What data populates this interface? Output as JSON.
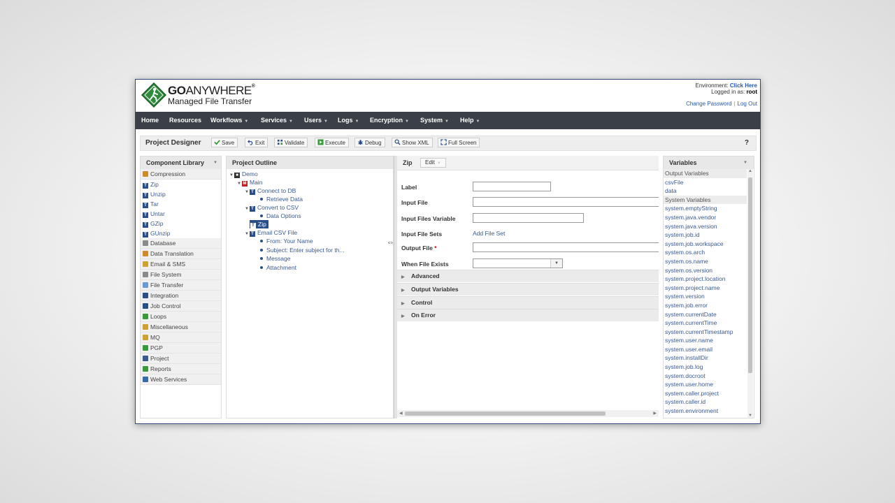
{
  "brand": {
    "go": "GO",
    "anywhere": "ANYWHERE",
    "reg": "®",
    "subtitle": "Managed File Transfer"
  },
  "env": {
    "environment_label": "Environment:",
    "environment_link": "Click Here",
    "logged_label": "Logged in as:",
    "user": "root",
    "change_password": "Change Password",
    "separator": "|",
    "logout": "Log Out"
  },
  "nav": [
    "Home",
    "Resources",
    "Workflows",
    "Services",
    "Users",
    "Logs",
    "Encryption",
    "System",
    "Help"
  ],
  "toolbar": {
    "title": "Project Designer",
    "save": "Save",
    "exit": "Exit",
    "validate": "Validate",
    "execute": "Execute",
    "debug": "Debug",
    "show_xml": "Show XML",
    "full_screen": "Full Screen",
    "help": "?"
  },
  "component_library": {
    "title": "Component Library",
    "items": [
      {
        "label": "Compression",
        "cat": true
      },
      {
        "label": "Zip",
        "cat": false
      },
      {
        "label": "Unzip",
        "cat": false
      },
      {
        "label": "Tar",
        "cat": false
      },
      {
        "label": "Untar",
        "cat": false
      },
      {
        "label": "GZip",
        "cat": false
      },
      {
        "label": "GUnzip",
        "cat": false
      },
      {
        "label": "Database",
        "cat": true
      },
      {
        "label": "Data Translation",
        "cat": true
      },
      {
        "label": "Email & SMS",
        "cat": true
      },
      {
        "label": "File System",
        "cat": true
      },
      {
        "label": "File Transfer",
        "cat": true
      },
      {
        "label": "Integration",
        "cat": true
      },
      {
        "label": "Job Control",
        "cat": true
      },
      {
        "label": "Loops",
        "cat": true
      },
      {
        "label": "Miscellaneous",
        "cat": true
      },
      {
        "label": "MQ",
        "cat": true
      },
      {
        "label": "PGP",
        "cat": true
      },
      {
        "label": "Project",
        "cat": true
      },
      {
        "label": "Reports",
        "cat": true
      },
      {
        "label": "Web Services",
        "cat": true
      }
    ]
  },
  "outline": {
    "title": "Project Outline",
    "demo": "Demo",
    "main": "Main",
    "connect_db": "Connect to DB",
    "retrieve_data": "Retrieve Data",
    "convert_csv": "Convert to CSV",
    "data_options": "Data Options",
    "zip": "Zip",
    "email_csv": "Email CSV File",
    "from": "From: Your Name",
    "subject": "Subject: Enter subject for th...",
    "message": "Message",
    "attachment": "Attachment"
  },
  "form": {
    "title": "Zip",
    "edit": "Edit",
    "label": "Label",
    "input_file": "Input File",
    "input_files_variable": "Input Files Variable",
    "input_file_sets": "Input File Sets",
    "add_file_set": "Add File Set",
    "output_file": "Output File",
    "required": "*",
    "when_file_exists": "When File Exists",
    "sections": [
      "Advanced",
      "Output Variables",
      "Control",
      "On Error"
    ]
  },
  "variables": {
    "title": "Variables",
    "items": [
      {
        "label": "Output Variables",
        "cat": true
      },
      {
        "label": "csvFile",
        "cat": false
      },
      {
        "label": "data",
        "cat": false
      },
      {
        "label": "System Variables",
        "cat": true
      },
      {
        "label": "system.emptyString",
        "cat": false
      },
      {
        "label": "system.java.vendor",
        "cat": false
      },
      {
        "label": "system.java.version",
        "cat": false
      },
      {
        "label": "system.job.id",
        "cat": false
      },
      {
        "label": "system.job.workspace",
        "cat": false
      },
      {
        "label": "system.os.arch",
        "cat": false
      },
      {
        "label": "system.os.name",
        "cat": false
      },
      {
        "label": "system.os.version",
        "cat": false
      },
      {
        "label": "system.project.location",
        "cat": false
      },
      {
        "label": "system.project.name",
        "cat": false
      },
      {
        "label": "system.version",
        "cat": false
      },
      {
        "label": "system.job.error",
        "cat": false
      },
      {
        "label": "system.currentDate",
        "cat": false
      },
      {
        "label": "system.currentTime",
        "cat": false
      },
      {
        "label": "system.currentTimestamp",
        "cat": false
      },
      {
        "label": "system.user.name",
        "cat": false
      },
      {
        "label": "system.user.email",
        "cat": false
      },
      {
        "label": "system.installDir",
        "cat": false
      },
      {
        "label": "system.job.log",
        "cat": false
      },
      {
        "label": "system.docroot",
        "cat": false
      },
      {
        "label": "system.user.home",
        "cat": false
      },
      {
        "label": "system.caller.project",
        "cat": false
      },
      {
        "label": "system.caller.id",
        "cat": false
      },
      {
        "label": "system.environment",
        "cat": false
      }
    ]
  },
  "colors": {
    "nav_bg": "#3b3f48",
    "link": "#3a5a8c",
    "selected": "#2a4f88",
    "logo_green": "#2e8b3a"
  }
}
